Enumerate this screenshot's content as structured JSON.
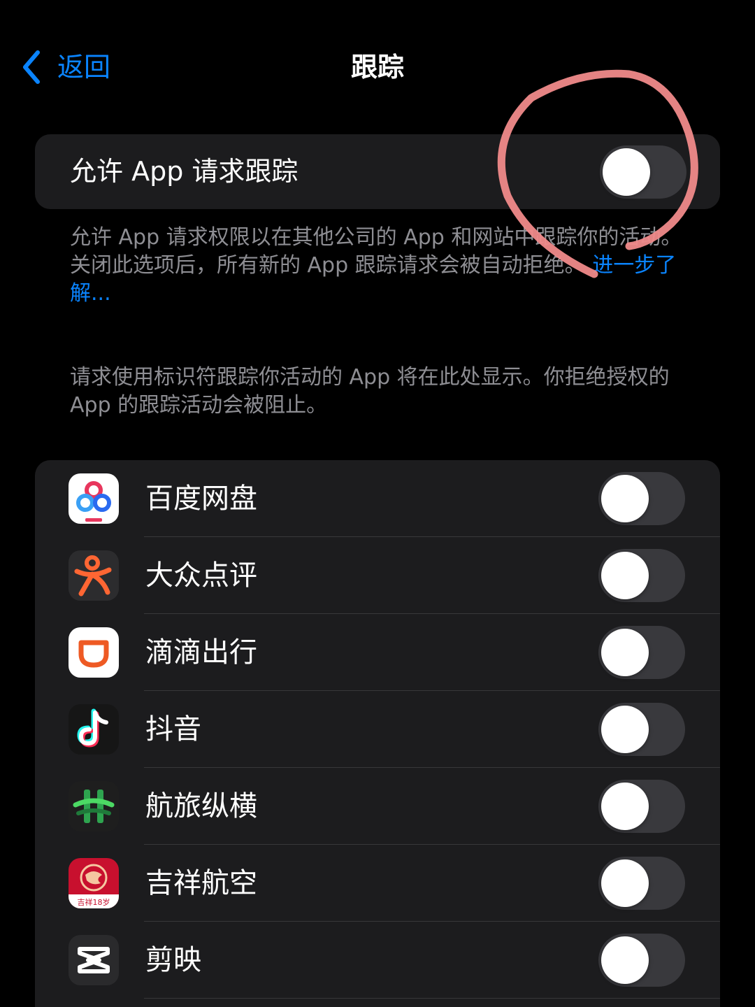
{
  "nav": {
    "back_label": "返回",
    "title": "跟踪"
  },
  "tracking": {
    "label": "允许 App 请求跟踪",
    "enabled": false,
    "description": "允许 App 请求权限以在其他公司的 App 和网站中跟踪你的活动。关闭此选项后，所有新的 App 跟踪请求会被自动拒绝。",
    "learn_more": "进一步了解..."
  },
  "apps_description": "请求使用标识符跟踪你活动的 App 将在此处显示。你拒绝授权的 App 的跟踪活动会被阻止。",
  "apps": [
    {
      "name": "百度网盘",
      "icon": "baidu-netdisk-icon",
      "allowed": false
    },
    {
      "name": "大众点评",
      "icon": "dianping-icon",
      "allowed": false
    },
    {
      "name": "滴滴出行",
      "icon": "didi-icon",
      "allowed": false
    },
    {
      "name": "抖音",
      "icon": "douyin-icon",
      "allowed": false
    },
    {
      "name": "航旅纵横",
      "icon": "hanglv-icon",
      "allowed": false
    },
    {
      "name": "吉祥航空",
      "icon": "juneyao-air-icon",
      "allowed": false,
      "icon_text": "吉祥18岁"
    },
    {
      "name": "剪映",
      "icon": "capcut-icon",
      "allowed": false
    }
  ],
  "colors": {
    "accent": "#0a84ff",
    "background": "#000000",
    "cell": "#1c1c1e",
    "toggle_off": "#39393d",
    "secondary_text": "#8e8e93",
    "annotation": "#f08a8a"
  }
}
